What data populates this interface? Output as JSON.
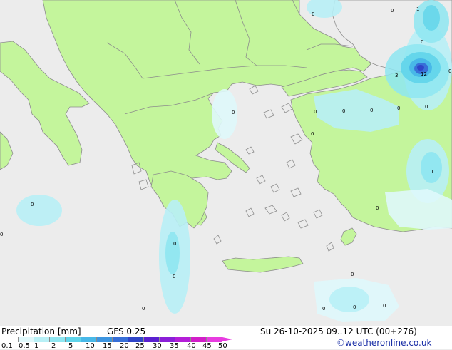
{
  "title": "Precipitation [mm]",
  "model": "GFS 0.25",
  "valid_time": "Su 26-10-2025 09..12 UTC (00+276)",
  "credit": "©weatheronline.co.uk",
  "legend": {
    "ticks": [
      "0.1",
      "0.5",
      "1",
      "2",
      "5",
      "10",
      "15",
      "20",
      "25",
      "30",
      "35",
      "40",
      "45",
      "50"
    ],
    "colors": [
      "#ffffff",
      "#dff8fb",
      "#b8f0f6",
      "#8ee6f1",
      "#5fd4ea",
      "#48b8e8",
      "#3d95e0",
      "#3870d8",
      "#2f45c8",
      "#5a1fd0",
      "#8b1fd8",
      "#b41ed8",
      "#d21ec8",
      "#e83ce0"
    ]
  },
  "map": {
    "land_color": "#c4f59c",
    "sea_color": "#ececec",
    "border_color": "#8c8c8c",
    "point_values": [
      "0",
      "1",
      "0",
      "0",
      "1",
      "3",
      "12",
      "0",
      "0",
      "0",
      "0",
      "0",
      "0",
      "1",
      "0",
      "0",
      "0",
      "0",
      "0",
      "0",
      "0",
      "0",
      "0",
      "0",
      "0",
      "0"
    ]
  }
}
